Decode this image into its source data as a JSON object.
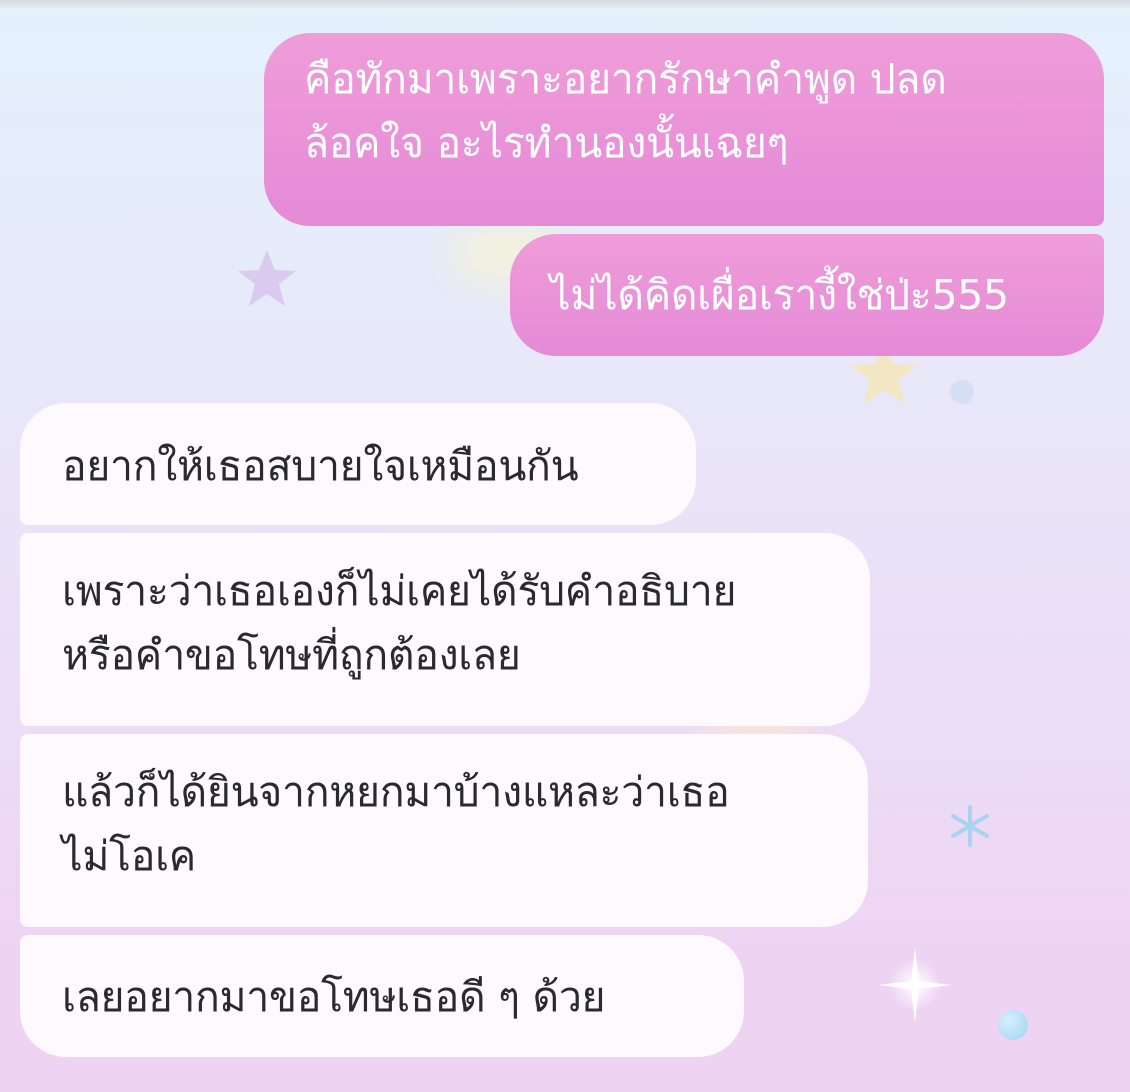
{
  "chat": {
    "messages": [
      {
        "direction": "sent",
        "lines": [
          "คือทักมาเพราะอยากรักษาคำพูด ปลด",
          "ล้อคใจ อะไรทำนองนั้นเฉยๆ"
        ]
      },
      {
        "direction": "sent",
        "lines": [
          "ไม่ได้คิดเผื่อเรางี้ใช่ป่ะ555"
        ]
      },
      {
        "direction": "received",
        "lines": [
          "อยากให้เธอสบายใจเหมือนกัน"
        ]
      },
      {
        "direction": "received",
        "lines": [
          "เพราะว่าเธอเองก็ไม่เคยได้รับคำอธิบาย",
          "หรือคำขอโทษที่ถูกต้องเลย"
        ]
      },
      {
        "direction": "received",
        "lines": [
          "แล้วก็ได้ยินจากหยกมาบ้างแหละว่าเธอ",
          "ไม่โอเค"
        ]
      },
      {
        "direction": "received",
        "lines": [
          "เลยอยากมาขอโทษเธอดี ๆ ด้วย"
        ]
      }
    ]
  },
  "theme": {
    "sent_bubble_color": "#e993d8",
    "received_bubble_color": "#fdf9fd",
    "sent_text_color": "#ffffff",
    "received_text_color": "#2a2a2a"
  },
  "background": {
    "decorations": [
      "star-icon",
      "star-icon",
      "asterisk-icon",
      "sparkle-icon",
      "bubble-dot"
    ]
  }
}
